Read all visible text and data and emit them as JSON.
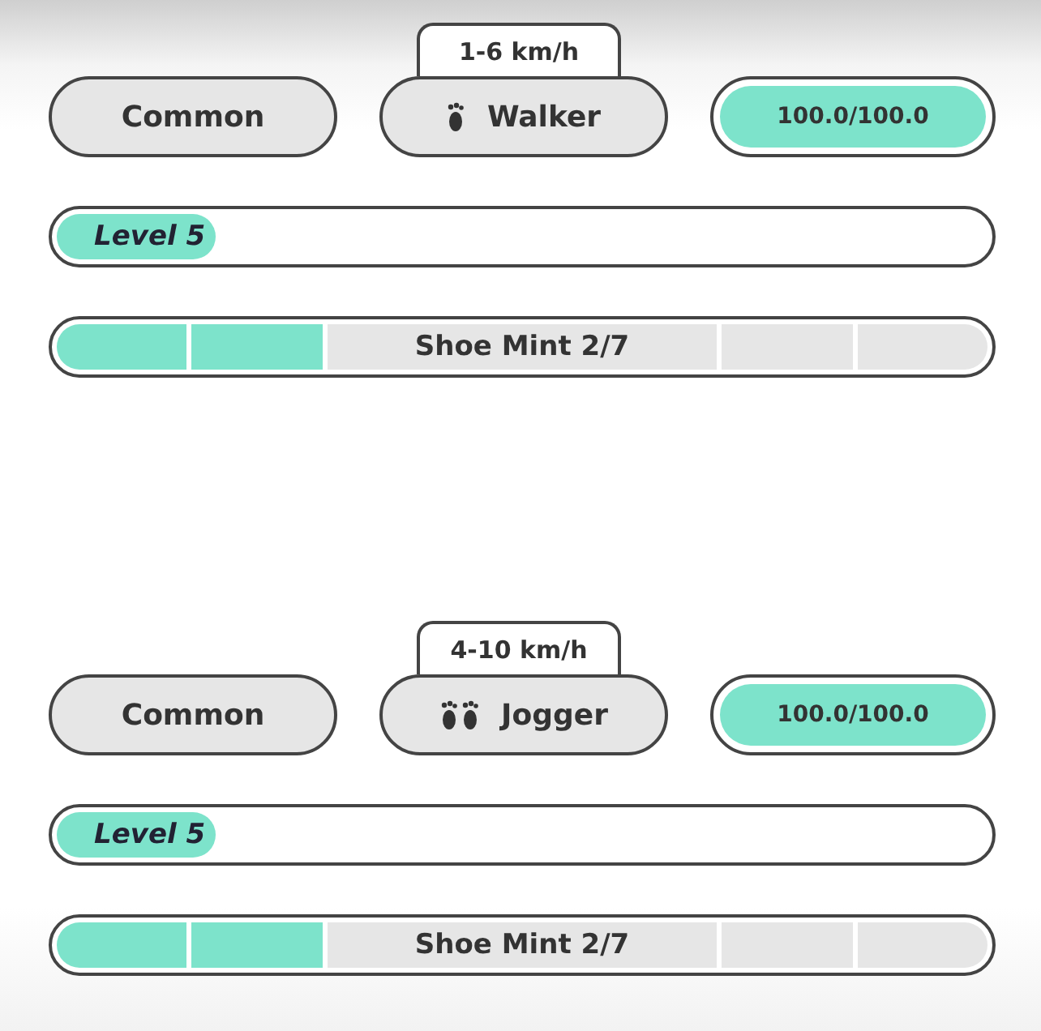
{
  "shoes": [
    {
      "speed": "1-6 km/h",
      "kind": "walker",
      "type": "Walker",
      "rarity": "Common",
      "durability": {
        "text": "100.0/100.0",
        "level": 1
      },
      "level_bar": {
        "label": "Level 5",
        "level": 0.17
      },
      "mint": {
        "label": "Shoe Mint 2/7",
        "segments": [
          {
            "filled": true
          },
          {
            "filled": true
          },
          {
            "filled": false
          },
          {
            "filled": false
          },
          {
            "filled": false
          },
          {
            "filled": false
          },
          {
            "filled": false
          }
        ]
      }
    },
    {
      "speed": "4-10 km/h",
      "kind": "jogger",
      "type": "Jogger",
      "rarity": "Common",
      "durability": {
        "text": "100.0/100.0",
        "level": 1
      },
      "level_bar": {
        "label": "Level 5",
        "level": 0.17
      },
      "mint": {
        "label": "Shoe Mint 2/7",
        "segments": [
          {
            "filled": true
          },
          {
            "filled": true
          },
          {
            "filled": false
          },
          {
            "filled": false
          },
          {
            "filled": false
          },
          {
            "filled": false
          },
          {
            "filled": false
          }
        ]
      }
    }
  ]
}
